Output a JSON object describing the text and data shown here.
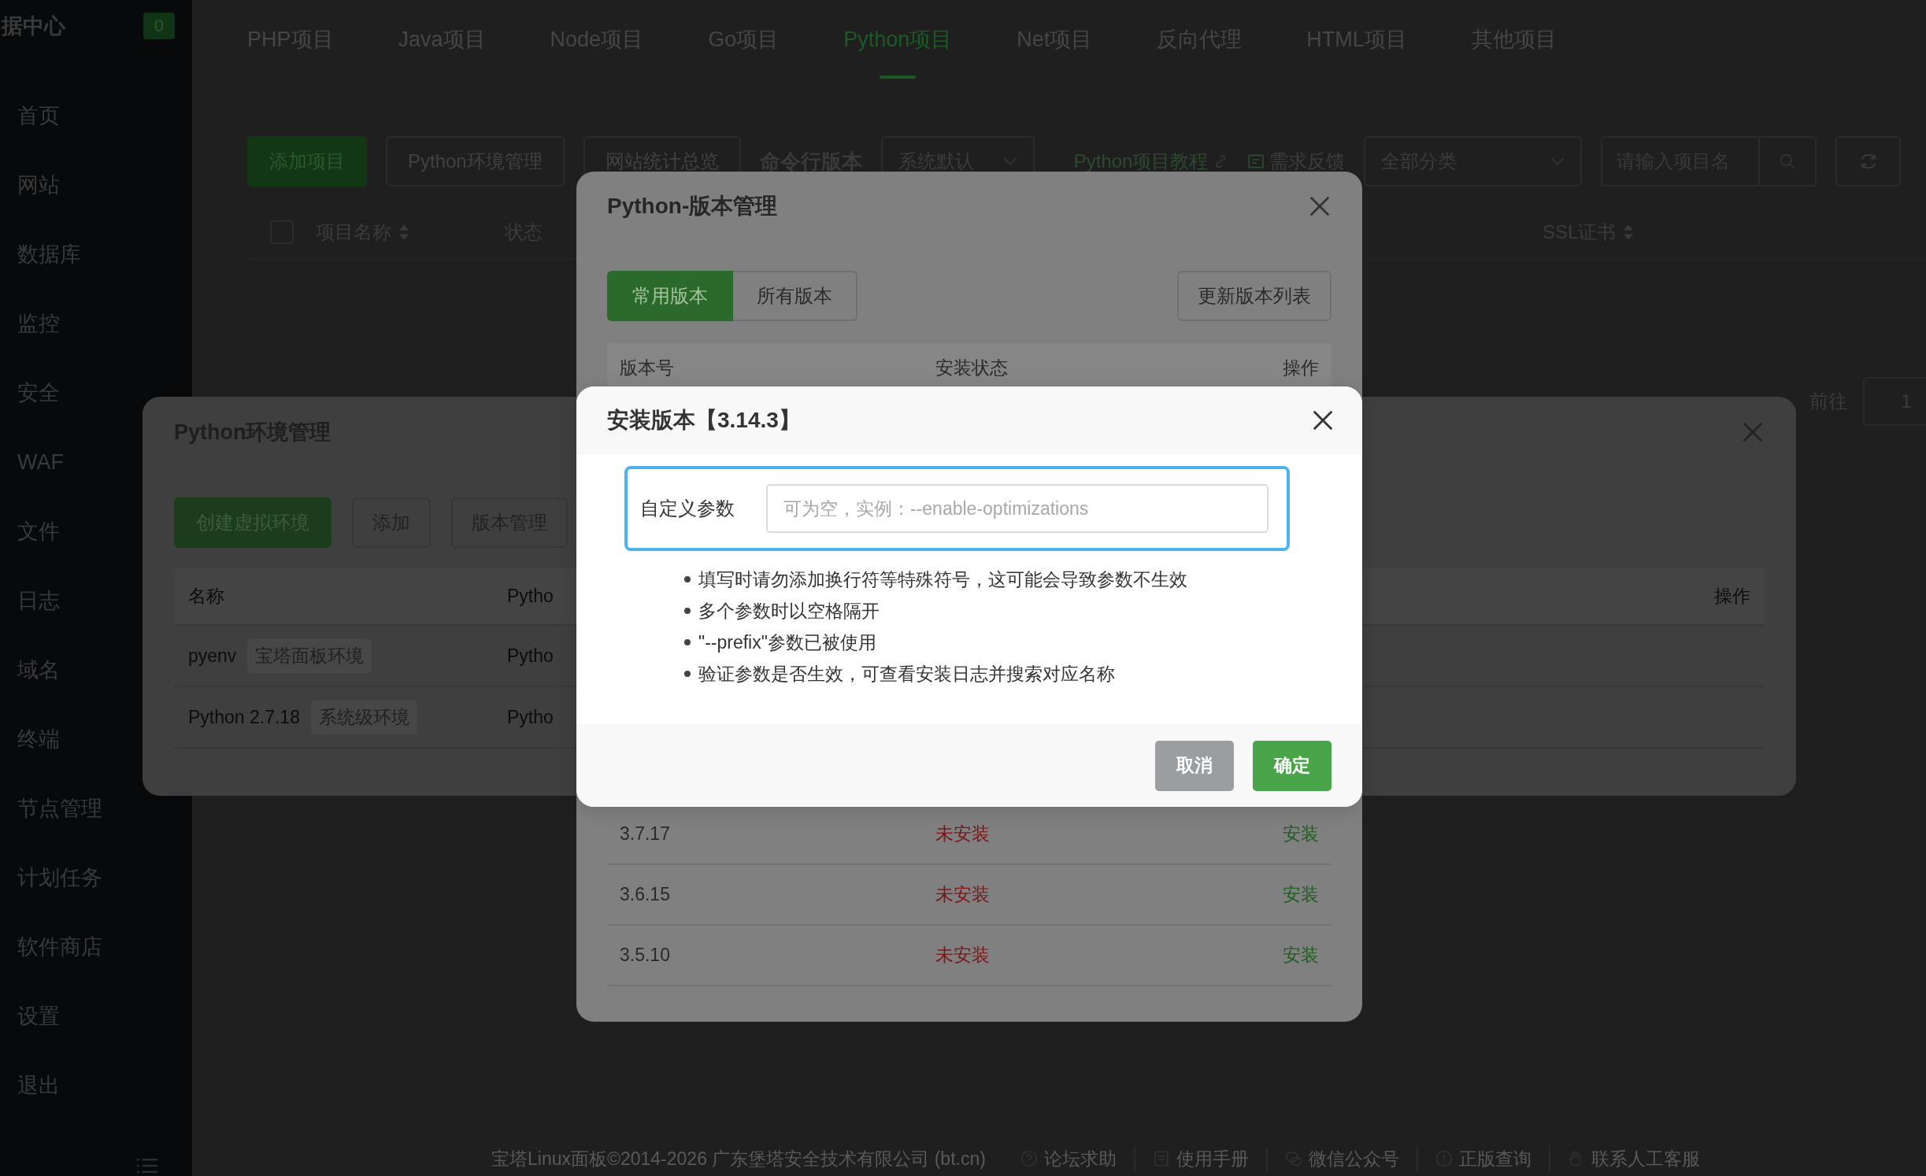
{
  "sidebar": {
    "title": "据中心",
    "badge": "0",
    "items": [
      {
        "label": "首页"
      },
      {
        "label": "网站"
      },
      {
        "label": "数据库"
      },
      {
        "label": "监控"
      },
      {
        "label": "安全"
      },
      {
        "label": "WAF"
      },
      {
        "label": "文件"
      },
      {
        "label": "日志"
      },
      {
        "label": "域名"
      },
      {
        "label": "终端"
      },
      {
        "label": "节点管理"
      },
      {
        "label": "计划任务"
      },
      {
        "label": "软件商店"
      },
      {
        "label": "设置"
      },
      {
        "label": "退出"
      }
    ]
  },
  "project_tabs": [
    {
      "label": "PHP项目",
      "selected": false
    },
    {
      "label": "Java项目",
      "selected": false
    },
    {
      "label": "Node项目",
      "selected": false
    },
    {
      "label": "Go项目",
      "selected": false
    },
    {
      "label": "Python项目",
      "selected": true
    },
    {
      "label": "Net项目",
      "selected": false
    },
    {
      "label": "反向代理",
      "selected": false
    },
    {
      "label": "HTML项目",
      "selected": false
    },
    {
      "label": "其他项目",
      "selected": false
    }
  ],
  "toolbar": {
    "add_button": "添加项目",
    "env_button": "Python环境管理",
    "stats_button": "网站统计总览",
    "cli_version_label": "命令行版本",
    "cli_version_select": "系统默认",
    "tutorial_link": "Python项目教程",
    "feedback_link": "需求反馈",
    "category_select": "全部分类",
    "search": {
      "placeholder": "请输入项目名"
    }
  },
  "table": {
    "select_all": {
      "checked": false
    },
    "columns": [
      {
        "label": "项目名称",
        "sortable": true
      },
      {
        "label": "状态",
        "sortable": false
      },
      {
        "label": "SSL证书",
        "sortable": true
      }
    ]
  },
  "pagination": {
    "goto_label": "前往",
    "page": "1"
  },
  "footer": {
    "copyright": "宝塔Linux面板©2014-2026 广东堡塔安全技术有限公司 (bt.cn)",
    "links": [
      {
        "label": "论坛求助",
        "kind": "help"
      },
      {
        "label": "使用手册",
        "kind": "manual"
      },
      {
        "label": "微信公众号",
        "kind": "wechat"
      },
      {
        "label": "正版查询",
        "kind": "info"
      },
      {
        "label": "联系人工客服",
        "kind": "support"
      }
    ]
  },
  "env_dialog": {
    "title": "Python环境管理",
    "buttons": [
      {
        "label": "创建虚拟环境",
        "kind": "primary"
      },
      {
        "label": "添加",
        "kind": "default"
      },
      {
        "label": "版本管理",
        "kind": "default"
      }
    ],
    "columns": [
      {
        "label": "名称"
      },
      {
        "label": "Pytho"
      },
      {
        "label": "操作"
      }
    ],
    "rows": [
      {
        "name": "pyenv",
        "tag": "宝塔面板环境",
        "column_2": "Pytho"
      },
      {
        "name": "Python 2.7.18",
        "tag": "系统级环境",
        "column_2": "Pytho"
      }
    ]
  },
  "version_dialog": {
    "title": "Python-版本管理",
    "tabs": [
      {
        "label": "常用版本",
        "selected": true
      },
      {
        "label": "所有版本",
        "selected": false
      }
    ],
    "refresh_button": "更新版本列表",
    "columns": [
      {
        "label": "版本号"
      },
      {
        "label": "安装状态"
      },
      {
        "label": "操作"
      }
    ],
    "rows": [
      {
        "version": "3.7.17",
        "status": "未安装",
        "installed": false,
        "action": "安装"
      },
      {
        "version": "3.6.15",
        "status": "未安装",
        "installed": false,
        "action": "安装"
      },
      {
        "version": "3.5.10",
        "status": "未安装",
        "installed": false,
        "action": "安装"
      }
    ]
  },
  "install_dialog": {
    "title": "安装版本【3.14.3】",
    "field": {
      "label": "自定义参数",
      "placeholder": "可为空，实例：--enable-optimizations"
    },
    "notes": [
      "填写时请勿添加换行符等特殊符号，这可能会导致参数不生效",
      "多个参数时以空格隔开",
      "\"--prefix\"参数已被使用",
      "验证参数是否生效，可查看安装日志并搜索对应名称"
    ],
    "buttons": [
      {
        "label": "取消",
        "kind": "cancel"
      },
      {
        "label": "确定",
        "kind": "confirm"
      }
    ]
  }
}
